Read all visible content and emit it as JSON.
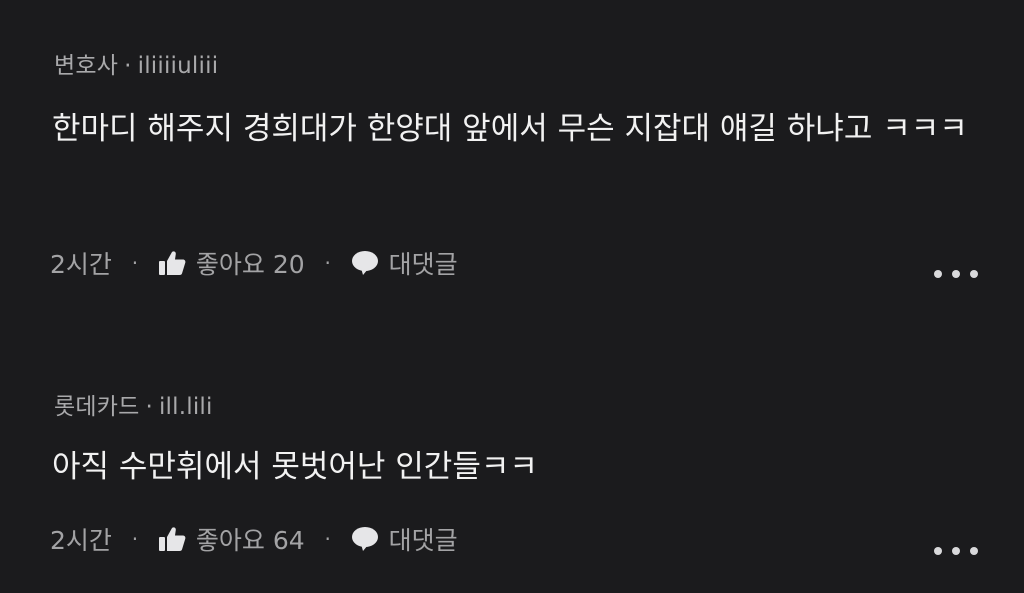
{
  "comments": [
    {
      "author": "변호사",
      "separator": "·",
      "user_id": "iliiiiuliii",
      "text": "한마디 해주지 경희대가 한양대 앞에서 무슨 지잡대 얘길 하냐고 ㅋㅋㅋ",
      "time": "2시간",
      "like_icon": "thumbs-up-icon",
      "likes_label": "좋아요 20",
      "reply_icon": "speech-bubble-icon",
      "reply_label": "대댓글",
      "more_icon": "more-dots-icon"
    },
    {
      "author": "롯데카드",
      "separator": "·",
      "user_id": "ill.lili",
      "text": "아직 수만휘에서 못벗어난 인간들ㅋㅋ",
      "time": "2시간",
      "like_icon": "thumbs-up-icon",
      "likes_label": "좋아요 64",
      "reply_icon": "speech-bubble-icon",
      "reply_label": "대댓글",
      "more_icon": "more-dots-icon"
    }
  ],
  "colors": {
    "background": "#1b1b1d",
    "primary_text": "#f2f2f2",
    "secondary_text": "#a9a9ab"
  }
}
